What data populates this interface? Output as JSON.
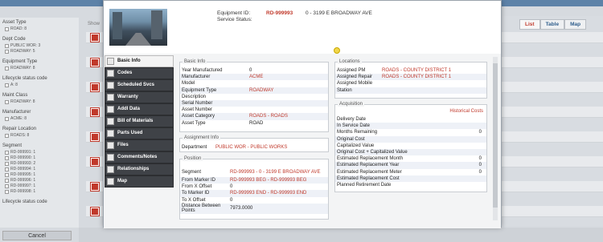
{
  "left_panel": {
    "groups": [
      {
        "title": "Asset Type",
        "options": [
          "ROAD: 8"
        ]
      },
      {
        "title": "Dept Code",
        "options": [
          "PUBLIC WOR: 3",
          "ROADWAY: 5"
        ]
      },
      {
        "title": "Equipment Type",
        "options": [
          "ROADWAY: 8"
        ]
      },
      {
        "title": "Lifecycle status code",
        "options": [
          "A: 8"
        ]
      },
      {
        "title": "Maint Class",
        "options": [
          "ROADWAY: 8"
        ]
      },
      {
        "title": "Manufacturer",
        "options": [
          "ACME: 8"
        ]
      },
      {
        "title": "Repair Location",
        "options": [
          "ROADS: 8"
        ]
      },
      {
        "title": "Segment",
        "options": [
          "RD-999991: 1",
          "RD-999990: 1",
          "RD-999993: 2",
          "RD-999994: 1",
          "RD-999995: 1",
          "RD-999996: 1",
          "RD-999997: 1",
          "RD-999998: 1"
        ]
      },
      {
        "title": "Lifecycle status code",
        "options": []
      }
    ],
    "cancel_label": "Cancel"
  },
  "list_header": {
    "show_label": "Show"
  },
  "view_tabs": [
    {
      "label": "List",
      "active": true
    },
    {
      "label": "Table",
      "active": false
    },
    {
      "label": "Map",
      "active": false
    }
  ],
  "header": {
    "equipment_id_label": "Equipment ID:",
    "equipment_id": "RD-999993",
    "equipment_name": "0 - 3199 E BROADWAY AVE",
    "service_status_label": "Service Status:"
  },
  "tabs": [
    {
      "label": "Basic Info",
      "icon": "info-icon",
      "active": true
    },
    {
      "label": "Codes",
      "icon": "codes-icon",
      "active": false
    },
    {
      "label": "Scheduled Svcs",
      "icon": "calendar-icon",
      "active": false
    },
    {
      "label": "Warranty",
      "icon": "warranty-icon",
      "active": false
    },
    {
      "label": "Addl Data",
      "icon": "data-icon",
      "active": false
    },
    {
      "label": "Bill of Materials",
      "icon": "bom-icon",
      "active": false
    },
    {
      "label": "Parts Used",
      "icon": "parts-icon",
      "active": false
    },
    {
      "label": "Files",
      "icon": "folder-icon",
      "active": false
    },
    {
      "label": "Comments/Notes",
      "icon": "comments-icon",
      "active": false
    },
    {
      "label": "Relationships",
      "icon": "relationships-icon",
      "active": false
    },
    {
      "label": "Map",
      "icon": "map-icon",
      "active": false
    }
  ],
  "basic_info": {
    "title": "Basic Info",
    "rows": [
      {
        "label": "Year Manufactured",
        "value": "0",
        "red": false
      },
      {
        "label": "Manufacturer",
        "value": "ACME",
        "red": true
      },
      {
        "label": "Model",
        "value": "",
        "red": false
      },
      {
        "label": "Equipment Type",
        "value": "ROADWAY",
        "red": true
      },
      {
        "label": "Description",
        "value": "",
        "red": false
      },
      {
        "label": "Serial Number",
        "value": "",
        "red": false
      },
      {
        "label": "Asset Number",
        "value": "",
        "red": false
      },
      {
        "label": "Asset Category",
        "value": "ROADS - ROADS",
        "red": true
      },
      {
        "label": "Asset Type",
        "value": "ROAD",
        "red": false
      }
    ]
  },
  "assignment_info": {
    "title": "Assignment Info",
    "rows": [
      {
        "label": "Department",
        "value": "PUBLIC WOR - PUBLIC WORKS",
        "red": true
      }
    ]
  },
  "position": {
    "title": "Position",
    "rows": [
      {
        "label": "Segment",
        "value": "RD-999993 - 0 - 3199 E BROADWAY AVE",
        "red": true
      },
      {
        "label": "From Marker ID",
        "value": "RD-999993 BEG - RD-999993 BEG",
        "red": true
      },
      {
        "label": "From X Offset",
        "value": "0",
        "red": false
      },
      {
        "label": "To Marker ID",
        "value": "RD-999993 END - RD-999993 END",
        "red": true
      },
      {
        "label": "To X Offset",
        "value": "0",
        "red": false
      },
      {
        "label": "Distance Between Points",
        "value": "7973.0000",
        "red": false
      }
    ]
  },
  "locations": {
    "title": "Locations",
    "rows": [
      {
        "label": "Assigned PM",
        "value": "ROADS - COUNTY DISTRICT 1",
        "red": true
      },
      {
        "label": "Assigned Repair",
        "value": "ROADS - COUNTY DISTRICT 1",
        "red": true
      },
      {
        "label": "Assigned Mobile",
        "value": "",
        "red": false
      },
      {
        "label": "Station",
        "value": "",
        "red": false
      }
    ]
  },
  "acquisition": {
    "title": "Acquisition",
    "link": "Historical Costs",
    "rows": [
      {
        "label": "Delivery Date",
        "value": ""
      },
      {
        "label": "In Service Date",
        "value": ""
      },
      {
        "label": "Months Remaining",
        "value": "0"
      },
      {
        "label": "Original Cost",
        "value": ""
      },
      {
        "label": "Capitalized Value",
        "value": ""
      },
      {
        "label": "Original Cost + Capitalized Value",
        "value": ""
      },
      {
        "label": "Estimated Replacement Month",
        "value": "0"
      },
      {
        "label": "Estimated Replacement Year",
        "value": "0"
      },
      {
        "label": "Estimated Replacement Meter",
        "value": "0"
      },
      {
        "label": "Estimated Replacement Cost",
        "value": ""
      },
      {
        "label": "Planned Retirement Date",
        "value": ""
      }
    ]
  },
  "colors": {
    "accent_red": "#c0392b",
    "nav_dark": "#3f4247",
    "link_blue": "#2f5e8c"
  }
}
